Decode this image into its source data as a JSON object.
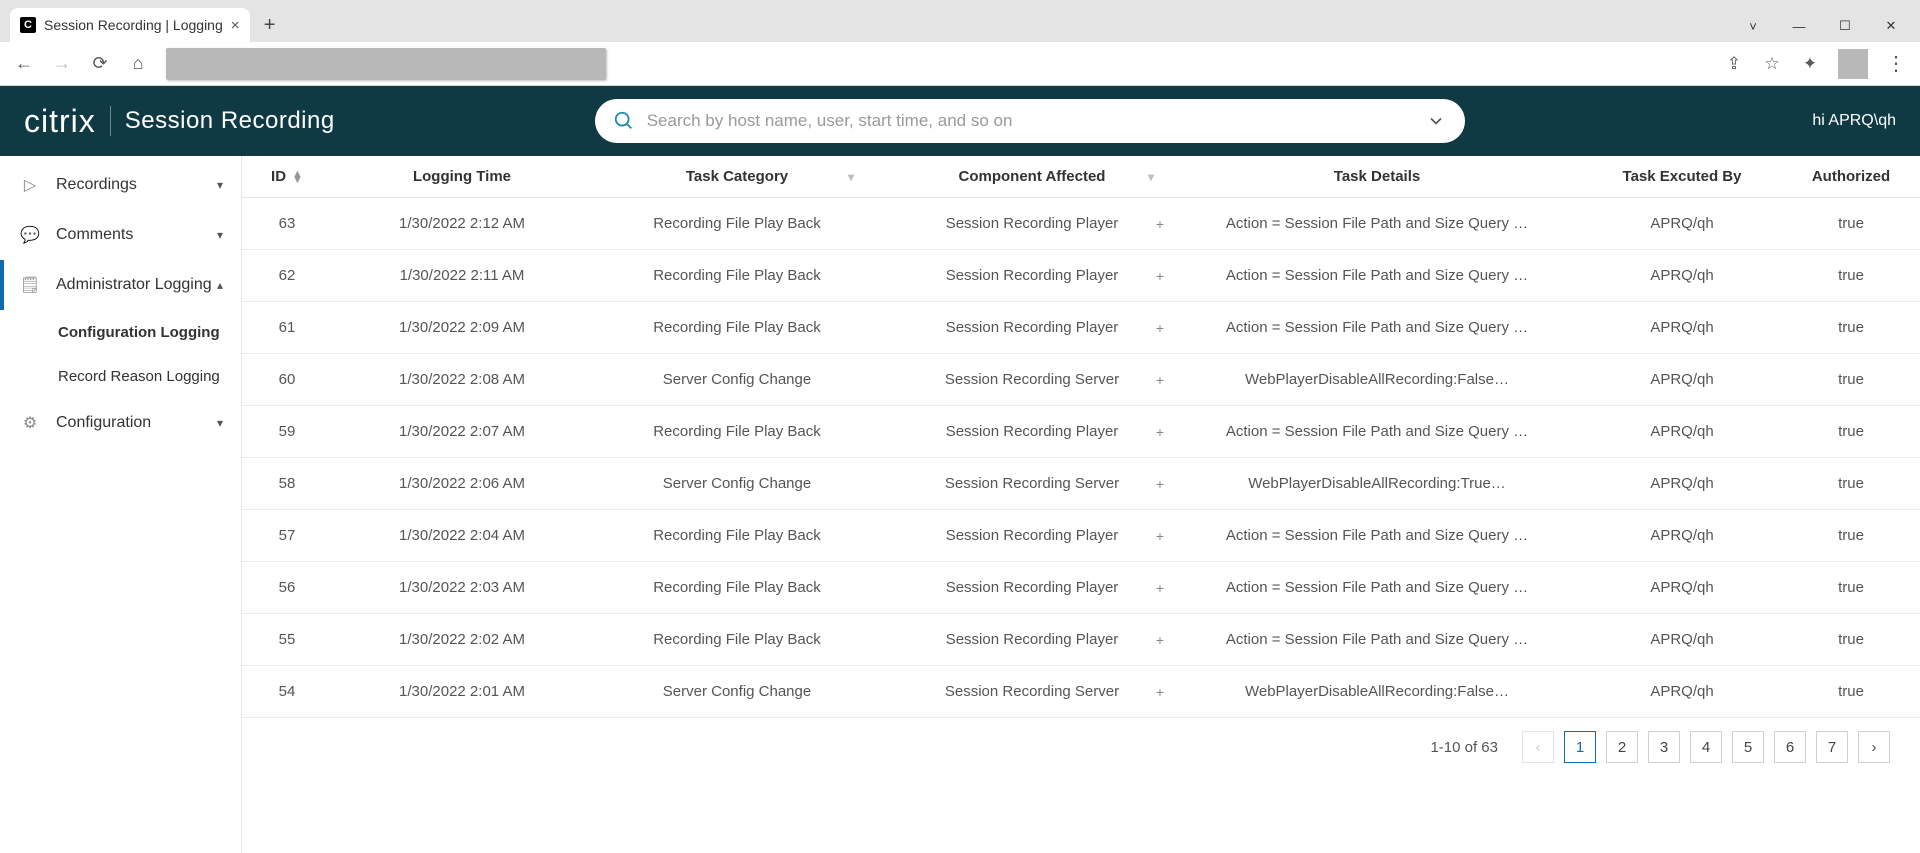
{
  "browser": {
    "tab_title": "Session Recording | Logging",
    "win_controls": {
      "min": "—",
      "max": "☐",
      "close": "✕"
    }
  },
  "header": {
    "brand": "citrix",
    "app_title": "Session Recording",
    "search_placeholder": "Search by host name, user, start time, and so on",
    "user_greeting": "hi APRQ\\qh"
  },
  "sidebar": {
    "items": [
      {
        "label": "Recordings",
        "expanded": false
      },
      {
        "label": "Comments",
        "expanded": false
      },
      {
        "label": "Administrator Logging",
        "expanded": true,
        "children": [
          {
            "label": "Configuration Logging",
            "current": true
          },
          {
            "label": "Record Reason Logging",
            "current": false
          }
        ]
      },
      {
        "label": "Configuration",
        "expanded": false
      }
    ]
  },
  "table": {
    "columns": {
      "id": "ID",
      "time": "Logging Time",
      "category": "Task Category",
      "component": "Component Affected",
      "details": "Task Details",
      "executed_by": "Task Excuted By",
      "authorized": "Authorized"
    },
    "rows": [
      {
        "id": "63",
        "time": "1/30/2022 2:12 AM",
        "category": "Recording File Play Back",
        "component": "Session Recording Player",
        "details": "Action = Session File Path and Size Query …",
        "executed_by": "APRQ/qh",
        "authorized": "true"
      },
      {
        "id": "62",
        "time": "1/30/2022 2:11 AM",
        "category": "Recording File Play Back",
        "component": "Session Recording Player",
        "details": "Action = Session File Path and Size Query …",
        "executed_by": "APRQ/qh",
        "authorized": "true"
      },
      {
        "id": "61",
        "time": "1/30/2022 2:09 AM",
        "category": "Recording File Play Back",
        "component": "Session Recording Player",
        "details": "Action = Session File Path and Size Query …",
        "executed_by": "APRQ/qh",
        "authorized": "true"
      },
      {
        "id": "60",
        "time": "1/30/2022 2:08 AM",
        "category": "Server Config Change",
        "component": "Session Recording Server",
        "details": "WebPlayerDisableAllRecording:False…",
        "executed_by": "APRQ/qh",
        "authorized": "true"
      },
      {
        "id": "59",
        "time": "1/30/2022 2:07 AM",
        "category": "Recording File Play Back",
        "component": "Session Recording Player",
        "details": "Action = Session File Path and Size Query …",
        "executed_by": "APRQ/qh",
        "authorized": "true"
      },
      {
        "id": "58",
        "time": "1/30/2022 2:06 AM",
        "category": "Server Config Change",
        "component": "Session Recording Server",
        "details": "WebPlayerDisableAllRecording:True…",
        "executed_by": "APRQ/qh",
        "authorized": "true"
      },
      {
        "id": "57",
        "time": "1/30/2022 2:04 AM",
        "category": "Recording File Play Back",
        "component": "Session Recording Player",
        "details": "Action = Session File Path and Size Query …",
        "executed_by": "APRQ/qh",
        "authorized": "true"
      },
      {
        "id": "56",
        "time": "1/30/2022 2:03 AM",
        "category": "Recording File Play Back",
        "component": "Session Recording Player",
        "details": "Action = Session File Path and Size Query …",
        "executed_by": "APRQ/qh",
        "authorized": "true"
      },
      {
        "id": "55",
        "time": "1/30/2022 2:02 AM",
        "category": "Recording File Play Back",
        "component": "Session Recording Player",
        "details": "Action = Session File Path and Size Query …",
        "executed_by": "APRQ/qh",
        "authorized": "true"
      },
      {
        "id": "54",
        "time": "1/30/2022 2:01 AM",
        "category": "Server Config Change",
        "component": "Session Recording Server",
        "details": "WebPlayerDisableAllRecording:False…",
        "executed_by": "APRQ/qh",
        "authorized": "true"
      }
    ]
  },
  "pagination": {
    "info": "1-10 of 63",
    "pages": [
      "1",
      "2",
      "3",
      "4",
      "5",
      "6",
      "7"
    ],
    "active": "1"
  }
}
